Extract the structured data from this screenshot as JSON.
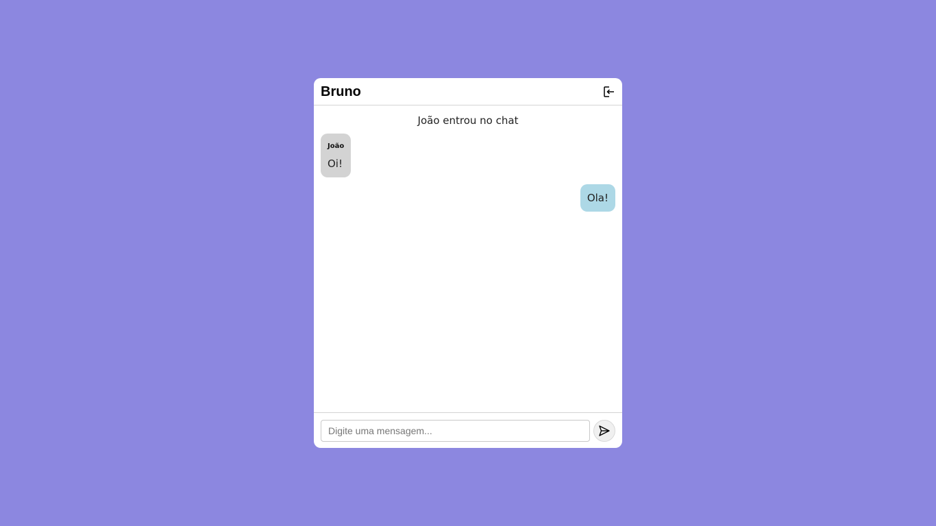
{
  "header": {
    "title": "Bruno",
    "logout_icon": "logout-icon"
  },
  "messages": {
    "system": "João entrou no chat",
    "received": [
      {
        "sender": "João",
        "text": "Oi!"
      }
    ],
    "sent": [
      {
        "text": "Ola!"
      }
    ]
  },
  "footer": {
    "input_value": "",
    "input_placeholder": "Digite uma mensagem...",
    "send_icon": "send-icon"
  },
  "colors": {
    "background": "#8c87e0",
    "received_bubble": "#d3d3d3",
    "sent_bubble": "#add8e6"
  }
}
